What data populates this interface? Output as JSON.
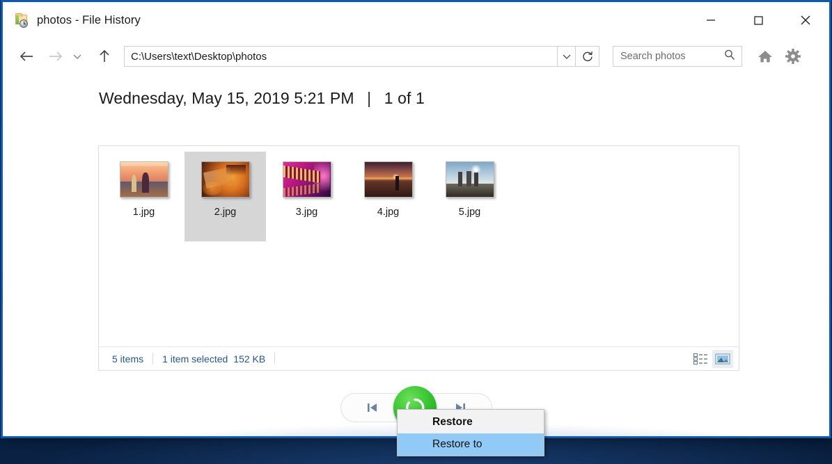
{
  "window": {
    "title": "photos - File History",
    "icon": "folder-history-icon",
    "controls": {
      "minimize": "Minimize",
      "maximize": "Maximize",
      "close": "Close"
    }
  },
  "navbar": {
    "back": "Back",
    "forward": "Forward",
    "recent": "Recent locations",
    "up": "Up one level",
    "address_value": "C:\\Users\\text\\Desktop\\photos",
    "address_dropdown": "Previous locations",
    "refresh": "Refresh",
    "search_placeholder": "Search photos",
    "search_value": "",
    "home_button": "Home",
    "settings_button": "Settings"
  },
  "header": {
    "date": "Wednesday, May 15, 2019 5:21 PM",
    "separator": "|",
    "counter": "1 of 1"
  },
  "files": [
    {
      "name": "1.jpg",
      "thumb": "t1",
      "selected": false
    },
    {
      "name": "2.jpg",
      "thumb": "t2",
      "selected": true
    },
    {
      "name": "3.jpg",
      "thumb": "t3",
      "selected": false
    },
    {
      "name": "4.jpg",
      "thumb": "t4",
      "selected": false
    },
    {
      "name": "5.jpg",
      "thumb": "t5",
      "selected": false
    }
  ],
  "status": {
    "item_count": "5 items",
    "selection": "1 item selected",
    "size": "152 KB",
    "view_details": "Details view",
    "view_large_icons": "Large icons view"
  },
  "bottom_nav": {
    "previous": "Previous version",
    "next": "Next version",
    "restore": "Restore"
  },
  "context_menu": {
    "items": [
      {
        "label": "Restore",
        "bold": true,
        "highlighted": false
      },
      {
        "label": "Restore to",
        "bold": false,
        "highlighted": true
      }
    ]
  },
  "colors": {
    "accent_blue": "#0a62b8",
    "restore_green": "#34c12e",
    "highlight_blue": "#91c9f7",
    "selection_gray": "#d6d6d6",
    "status_text": "#26568f",
    "desktop": "#0a2346"
  }
}
